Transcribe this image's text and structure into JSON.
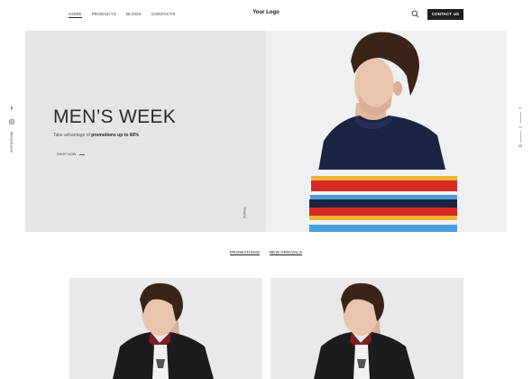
{
  "header": {
    "nav": [
      {
        "label": "HOME",
        "active": true
      },
      {
        "label": "PRODUCTS",
        "active": false
      },
      {
        "label": "BLOGS",
        "active": false
      },
      {
        "label": "CONTACTS",
        "active": false
      }
    ],
    "logo": "Your Logo",
    "contact_label": "CONTACT US"
  },
  "social": {
    "instagram_label": "INSTAGRAM"
  },
  "hero": {
    "title": "MEN’S WEEK",
    "sub_prefix": "Take advantage of ",
    "sub_bold": "promotions up to 60%",
    "shop_label": "SHOP NOW",
    "track_label": "TRACK",
    "pager": [
      "01",
      "02",
      "03"
    ],
    "pager_active": 2
  },
  "tabs": [
    "PROMOTIONS",
    "NEW ARRIVALS"
  ],
  "colors": {
    "accent": "#1e1e1e",
    "hero_bg": "#e4e5e7"
  }
}
